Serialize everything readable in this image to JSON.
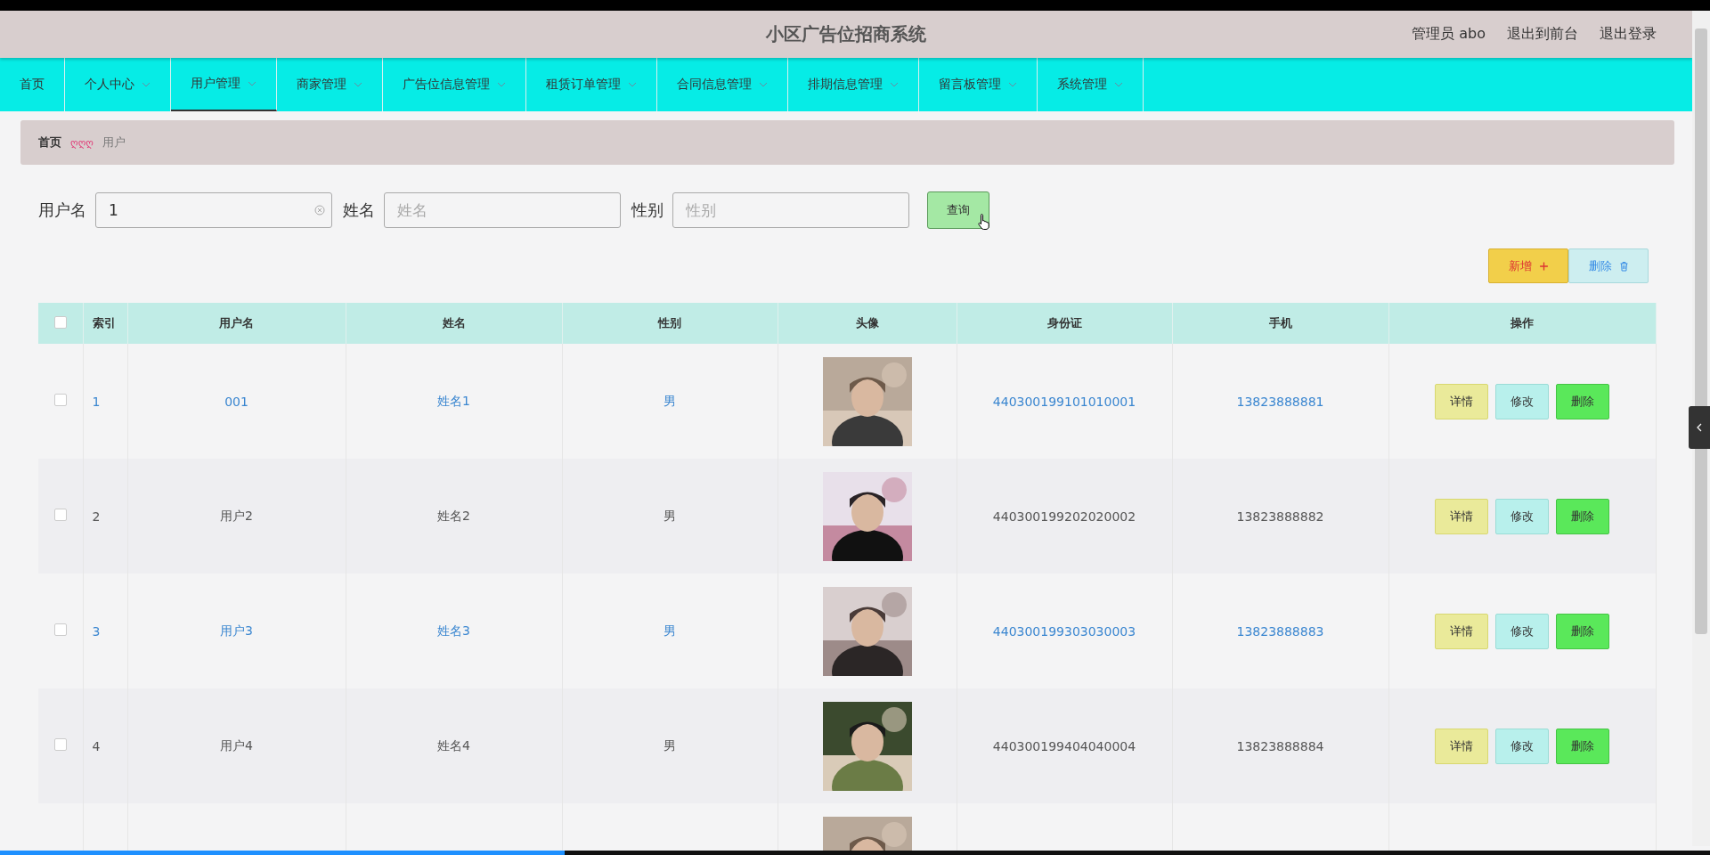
{
  "header": {
    "title": "小区广告位招商系统",
    "user": "管理员 abo",
    "links": [
      "退出到前台",
      "退出登录"
    ]
  },
  "nav": [
    {
      "label": "首页",
      "dropdown": false,
      "selected": false
    },
    {
      "label": "个人中心",
      "dropdown": true,
      "selected": false
    },
    {
      "label": "用户管理",
      "dropdown": true,
      "selected": true
    },
    {
      "label": "商家管理",
      "dropdown": true,
      "selected": false
    },
    {
      "label": "广告位信息管理",
      "dropdown": true,
      "selected": false
    },
    {
      "label": "租赁订单管理",
      "dropdown": true,
      "selected": false
    },
    {
      "label": "合同信息管理",
      "dropdown": true,
      "selected": false
    },
    {
      "label": "排期信息管理",
      "dropdown": true,
      "selected": false
    },
    {
      "label": "留言板管理",
      "dropdown": true,
      "selected": false
    },
    {
      "label": "系统管理",
      "dropdown": true,
      "selected": false
    }
  ],
  "breadcrumb": {
    "home": "首页",
    "separator": "ღღღ",
    "current": "用户"
  },
  "search": [
    {
      "label": "用户名",
      "value": "1",
      "clearable": true
    },
    {
      "label": "姓名",
      "placeholder": "姓名",
      "clearable": false
    },
    {
      "label": "性别",
      "placeholder": "性别",
      "clearable": false
    }
  ],
  "search_button": "查询",
  "actions": {
    "add": "新增",
    "delete": "删除"
  },
  "table": {
    "columns": [
      "索引",
      "用户名",
      "姓名",
      "性别",
      "头像",
      "身份证",
      "手机",
      "操作"
    ],
    "select_all": {
      "checked": false
    },
    "rows": [
      {
        "checked": false,
        "index": "1",
        "username": "001",
        "name": "姓名1",
        "gender": "男",
        "avatar": {
          "kind": "picture"
        },
        "id_card": "440300199101010001",
        "phone": "13823888881",
        "highlighted": true,
        "buttons": [
          "详情",
          "修改",
          "删除"
        ]
      },
      {
        "checked": false,
        "index": "2",
        "username": "用户2",
        "name": "姓名2",
        "gender": "男",
        "avatar": {
          "kind": "picture"
        },
        "id_card": "440300199202020002",
        "phone": "13823888882",
        "highlighted": false,
        "buttons": [
          "详情",
          "修改",
          "删除"
        ]
      },
      {
        "checked": false,
        "index": "3",
        "username": "用户3",
        "name": "姓名3",
        "gender": "男",
        "avatar": {
          "kind": "picture"
        },
        "id_card": "440300199303030003",
        "phone": "13823888883",
        "highlighted": true,
        "buttons": [
          "详情",
          "修改",
          "删除"
        ]
      },
      {
        "checked": false,
        "index": "4",
        "username": "用户4",
        "name": "姓名4",
        "gender": "男",
        "avatar": {
          "kind": "picture"
        },
        "id_card": "440300199404040004",
        "phone": "13823888884",
        "highlighted": false,
        "buttons": [
          "详情",
          "修改",
          "删除"
        ]
      },
      {
        "avatar": {
          "kind": "picture"
        }
      }
    ]
  },
  "video_progress": {
    "level": 0.33
  }
}
